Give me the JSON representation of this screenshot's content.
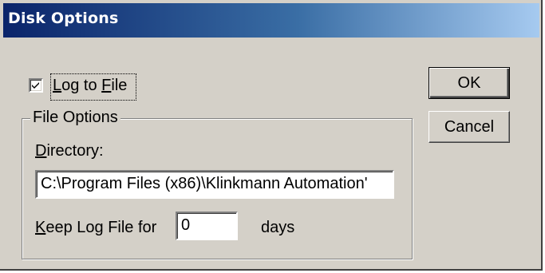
{
  "window": {
    "title": "Disk Options"
  },
  "log_to_file": {
    "checked": true,
    "label_access_key": "L",
    "label_mid": "og to ",
    "label_access_key2": "F",
    "label_rest": "ile"
  },
  "file_options": {
    "group_label": "File Options",
    "directory_label_key": "D",
    "directory_label_rest": "irectory:",
    "directory_value": "C:\\Program Files (x86)\\Klinkmann Automation'",
    "keep_label_key": "K",
    "keep_label_rest": "eep Log File for",
    "keep_value": "0",
    "days_label": "days"
  },
  "buttons": {
    "ok_label": "OK",
    "cancel_label": "Cancel"
  }
}
